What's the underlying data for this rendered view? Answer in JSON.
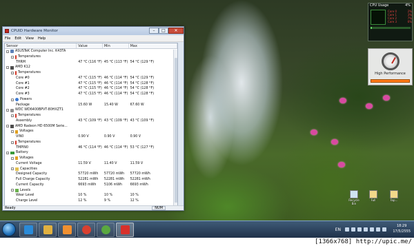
{
  "window": {
    "title": "CPUID Hardware Monitor",
    "menu": [
      "File",
      "Edit",
      "View",
      "Help"
    ],
    "columns": [
      "Sensor",
      "Value",
      "Min",
      "Max"
    ],
    "rows": [
      {
        "indent": 0,
        "exp": "-",
        "icon": "pc",
        "name": "ASUSTeK Computer Inc. K43TA",
        "value": "",
        "min": "",
        "max": ""
      },
      {
        "indent": 1,
        "exp": "-",
        "icon": "therm",
        "name": "Temperatures",
        "value": "",
        "min": "",
        "max": ""
      },
      {
        "indent": 2,
        "exp": "",
        "icon": "",
        "name": "THRM",
        "value": "47 °C  (116 °F)",
        "min": "45 °C  (113 °F)",
        "max": "54 °C  (129 °F)"
      },
      {
        "indent": 0,
        "exp": "-",
        "icon": "chip",
        "name": "AMD K12",
        "value": "",
        "min": "",
        "max": ""
      },
      {
        "indent": 1,
        "exp": "-",
        "icon": "therm",
        "name": "Temperatures",
        "value": "",
        "min": "",
        "max": ""
      },
      {
        "indent": 2,
        "exp": "",
        "icon": "",
        "name": "Core #0",
        "value": "47 °C  (115 °F)",
        "min": "46 °C  (114 °F)",
        "max": "54 °C  (129 °F)"
      },
      {
        "indent": 2,
        "exp": "",
        "icon": "",
        "name": "Core #1",
        "value": "47 °C  (115 °F)",
        "min": "46 °C  (114 °F)",
        "max": "54 °C  (128 °F)"
      },
      {
        "indent": 2,
        "exp": "",
        "icon": "",
        "name": "Core #2",
        "value": "47 °C  (115 °F)",
        "min": "46 °C  (114 °F)",
        "max": "54 °C  (128 °F)"
      },
      {
        "indent": 2,
        "exp": "",
        "icon": "",
        "name": "Core #3",
        "value": "47 °C  (115 °F)",
        "min": "46 °C  (114 °F)",
        "max": "54 °C  (128 °F)"
      },
      {
        "indent": 1,
        "exp": "-",
        "icon": "power",
        "name": "Powers",
        "value": "",
        "min": "",
        "max": ""
      },
      {
        "indent": 2,
        "exp": "",
        "icon": "",
        "name": "Package",
        "value": "15.60 W",
        "min": "15.40 W",
        "max": "67.60 W"
      },
      {
        "indent": 0,
        "exp": "-",
        "icon": "disk",
        "name": "WDC WD6400BPVT-80HXZT1",
        "value": "",
        "min": "",
        "max": ""
      },
      {
        "indent": 1,
        "exp": "-",
        "icon": "therm",
        "name": "Temperatures",
        "value": "",
        "min": "",
        "max": ""
      },
      {
        "indent": 2,
        "exp": "",
        "icon": "",
        "name": "Assembly",
        "value": "43 °C  (109 °F)",
        "min": "43 °C  (109 °F)",
        "max": "43 °C  (109 °F)"
      },
      {
        "indent": 0,
        "exp": "-",
        "icon": "chip",
        "name": "AMD Radeon HD 6500M Serie...",
        "value": "",
        "min": "",
        "max": ""
      },
      {
        "indent": 1,
        "exp": "-",
        "icon": "volt",
        "name": "Voltages",
        "value": "",
        "min": "",
        "max": ""
      },
      {
        "indent": 2,
        "exp": "",
        "icon": "",
        "name": "VIN0",
        "value": "0.90 V",
        "min": "0.90 V",
        "max": "0.90 V"
      },
      {
        "indent": 1,
        "exp": "-",
        "icon": "therm",
        "name": "Temperatures",
        "value": "",
        "min": "",
        "max": ""
      },
      {
        "indent": 2,
        "exp": "",
        "icon": "",
        "name": "TMPIN0",
        "value": "46 °C  (114 °F)",
        "min": "46 °C  (114 °F)",
        "max": "53 °C  (127 °F)"
      },
      {
        "indent": 0,
        "exp": "-",
        "icon": "battery",
        "name": "Battery",
        "value": "",
        "min": "",
        "max": ""
      },
      {
        "indent": 1,
        "exp": "-",
        "icon": "volt",
        "name": "Voltages",
        "value": "",
        "min": "",
        "max": ""
      },
      {
        "indent": 2,
        "exp": "",
        "icon": "",
        "name": "Current Voltage",
        "value": "11.59 V",
        "min": "11.40 V",
        "max": "11.59 V"
      },
      {
        "indent": 1,
        "exp": "-",
        "icon": "cap",
        "name": "Capacities",
        "value": "",
        "min": "",
        "max": ""
      },
      {
        "indent": 2,
        "exp": "",
        "icon": "",
        "name": "Designed Capacity",
        "value": "57720 mWh",
        "min": "57720 mWh",
        "max": "57720 mWh"
      },
      {
        "indent": 2,
        "exp": "",
        "icon": "",
        "name": "Full Charge Capacity",
        "value": "52281 mWh",
        "min": "52281 mWh",
        "max": "52281 mWh"
      },
      {
        "indent": 2,
        "exp": "",
        "icon": "",
        "name": "Current Capacity",
        "value": "6693 mWh",
        "min": "5106 mWh",
        "max": "6693 mWh"
      },
      {
        "indent": 1,
        "exp": "-",
        "icon": "level",
        "name": "Levels",
        "value": "",
        "min": "",
        "max": ""
      },
      {
        "indent": 2,
        "exp": "",
        "icon": "",
        "name": "Wear Level",
        "value": "10 %",
        "min": "10 %",
        "max": "10 %"
      },
      {
        "indent": 2,
        "exp": "",
        "icon": "",
        "name": "Charge Level",
        "value": "12 %",
        "min": "9 %",
        "max": "12 %"
      }
    ],
    "status": "Ready",
    "num_indicator": "NUM"
  },
  "cpu_gadget": {
    "title": "CPU Usage",
    "total": "4%",
    "cores": [
      {
        "label": "Core 0",
        "value": "2%"
      },
      {
        "label": "Core 1",
        "value": "3%"
      },
      {
        "label": "Core 2",
        "value": "7%"
      },
      {
        "label": "Core 3",
        "value": "6%"
      }
    ],
    "usage_fraction": 0.04
  },
  "hp_gadget": {
    "label": "High Performance"
  },
  "desktop_icons": [
    {
      "label": "Recycle Bin",
      "icon": "recycle-bin-icon"
    },
    {
      "label": "Full",
      "icon": "folder-icon"
    },
    {
      "label": "Fap...",
      "icon": "folder-icon"
    }
  ],
  "taskbar": {
    "pinned": [
      {
        "name": "internet-explorer",
        "icon": "ie-icon",
        "color": "#2a8ad8"
      },
      {
        "name": "explorer",
        "icon": "folder-icon",
        "color": "#e0b040"
      },
      {
        "name": "media-player",
        "icon": "media-player-icon",
        "color": "#f09030"
      },
      {
        "name": "chrome",
        "icon": "chrome-icon",
        "color": "#d84030"
      },
      {
        "name": "utorrent",
        "icon": "utorrent-icon",
        "color": "#5aa840"
      },
      {
        "name": "hwmonitor",
        "icon": "hwmonitor-icon",
        "color": "#d8302a"
      }
    ],
    "language": "EN",
    "time": "18:29",
    "date": "17/5/2555"
  },
  "footer": {
    "text": "[1366x768] http://upic.me/"
  }
}
